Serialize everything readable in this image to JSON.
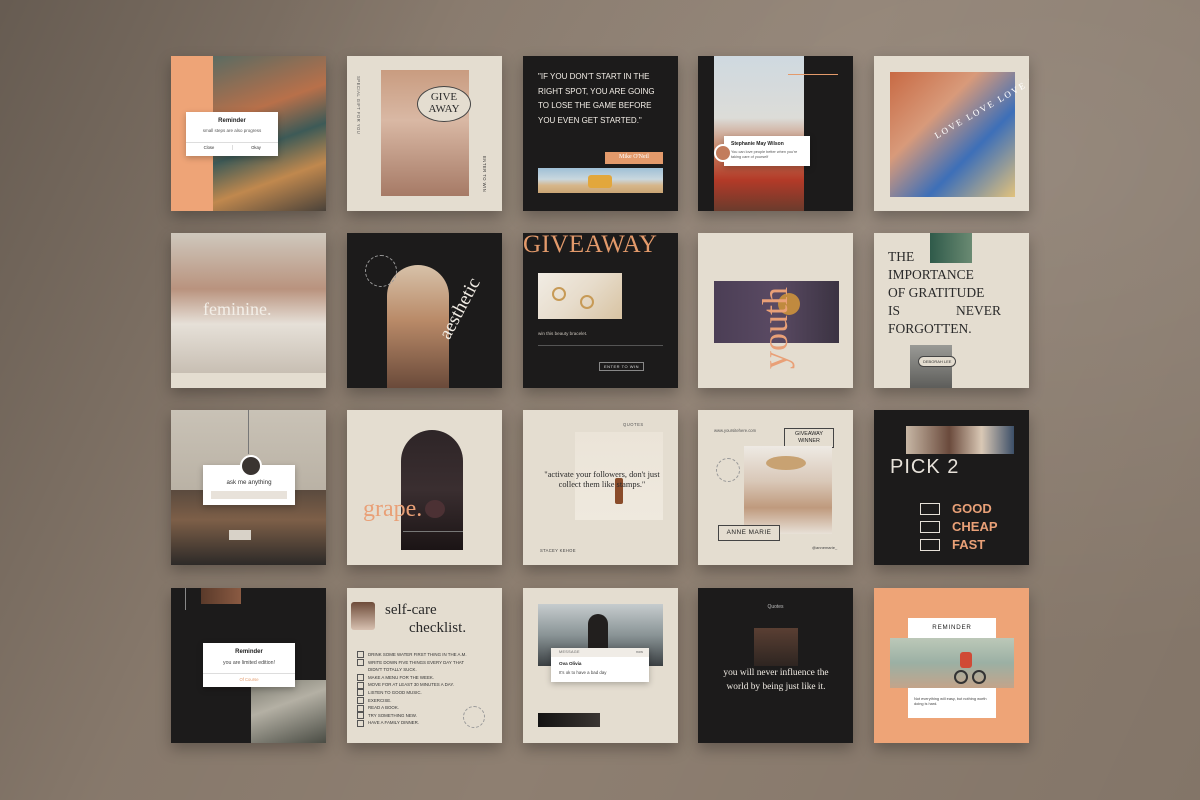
{
  "row1": {
    "reminder_title": "Reminder",
    "reminder_sub": "small steps are also progress",
    "reminder_close": "Close",
    "reminder_okay": "Okay",
    "give_line1": "GIVE",
    "give_line2": "AWAY",
    "special_gift": "SPECIAL GIFT FOR YOU",
    "enter_to_win": "ENTER TO WIN",
    "quote_text": "\"IF YOU DON'T START IN THE RIGHT SPOT, YOU ARE GOING TO LOSE THE GAME BEFORE YOU EVEN GET STARTED.\"",
    "quote_author": "Mike O'Neil",
    "testimonial_name": "Stephanie May Wilson",
    "testimonial_text": "You can love people better when you're taking care of yourself",
    "love_text": "LOVE LOVE LOVE LOVE"
  },
  "row2": {
    "feminine": "feminine.",
    "aesthetic": "aesthetic",
    "giveaway": "GIVEAWAY",
    "win_beauty": "win this beauty bracelet.",
    "enter_to_win": "ENTER TO WIN",
    "youth": "youth",
    "gratitude_line1": "THE",
    "gratitude_line2": "IMPORTANCE",
    "gratitude_line3": "OF GRATITUDE",
    "gratitude_line4": "IS",
    "gratitude_line5": "NEVER",
    "gratitude_line6": "FORGOTTEN.",
    "gratitude_author": "DEBORAH LEE"
  },
  "row3": {
    "ask_me": "ask me anything",
    "grape": "grape.",
    "quotes_label": "QUOTES",
    "activate_quote": "\"activate your followers, don't just collect them like stamps.\"",
    "activate_author": "STACEY KEHOE",
    "website": "www.yoursitehere.com",
    "giveaway_winner_1": "GIVEAWAY",
    "giveaway_winner_2": "WINNER",
    "winner_name": "ANNE MARIE",
    "winner_handle": "@annemarie_",
    "pick2": "PICK 2",
    "good": "GOOD",
    "cheap": "CHEAP",
    "fast": "FAST"
  },
  "row4": {
    "reminder_title": "Reminder",
    "reminder_sub": "you are limited edition!",
    "reminder_btn": "Of Course",
    "selfcare_1": "self-care",
    "selfcare_2": "checklist.",
    "checklist": [
      "DRINK SOME WATER FIRST THING IN THE A.M.",
      "WRITE DOWN FIVE THINGS EVERY DAY THAT",
      "DIDN'T TOTALLY SUCK.",
      "MAKE A MENU FOR THE WEEK.",
      "MOVE FOR AT LEAST 30 MINUTES A DAY.",
      "LISTEN TO GOOD MUSIC.",
      "EXERCISE.",
      "READ A BOOK.",
      "TRY SOMETHING NEW.",
      "HAVE A FAMILY DINNER."
    ],
    "message_label": "MESSAGE",
    "message_time": "now",
    "message_from": "Ova Olivia",
    "message_text": "It's ok to have a bad day",
    "quotes_label": "Quotes",
    "influence_quote": "you will never influence the world by being just like it.",
    "reminder_caps": "REMINDER",
    "reminder_note": "Not everything will easy, but nothing worth doing is hard."
  },
  "colors": {
    "background": "#8e7f71",
    "cream": "#e4ddd0",
    "dark": "#1c1b1b",
    "peach": "#eea477",
    "accent": "#e39a6b"
  }
}
